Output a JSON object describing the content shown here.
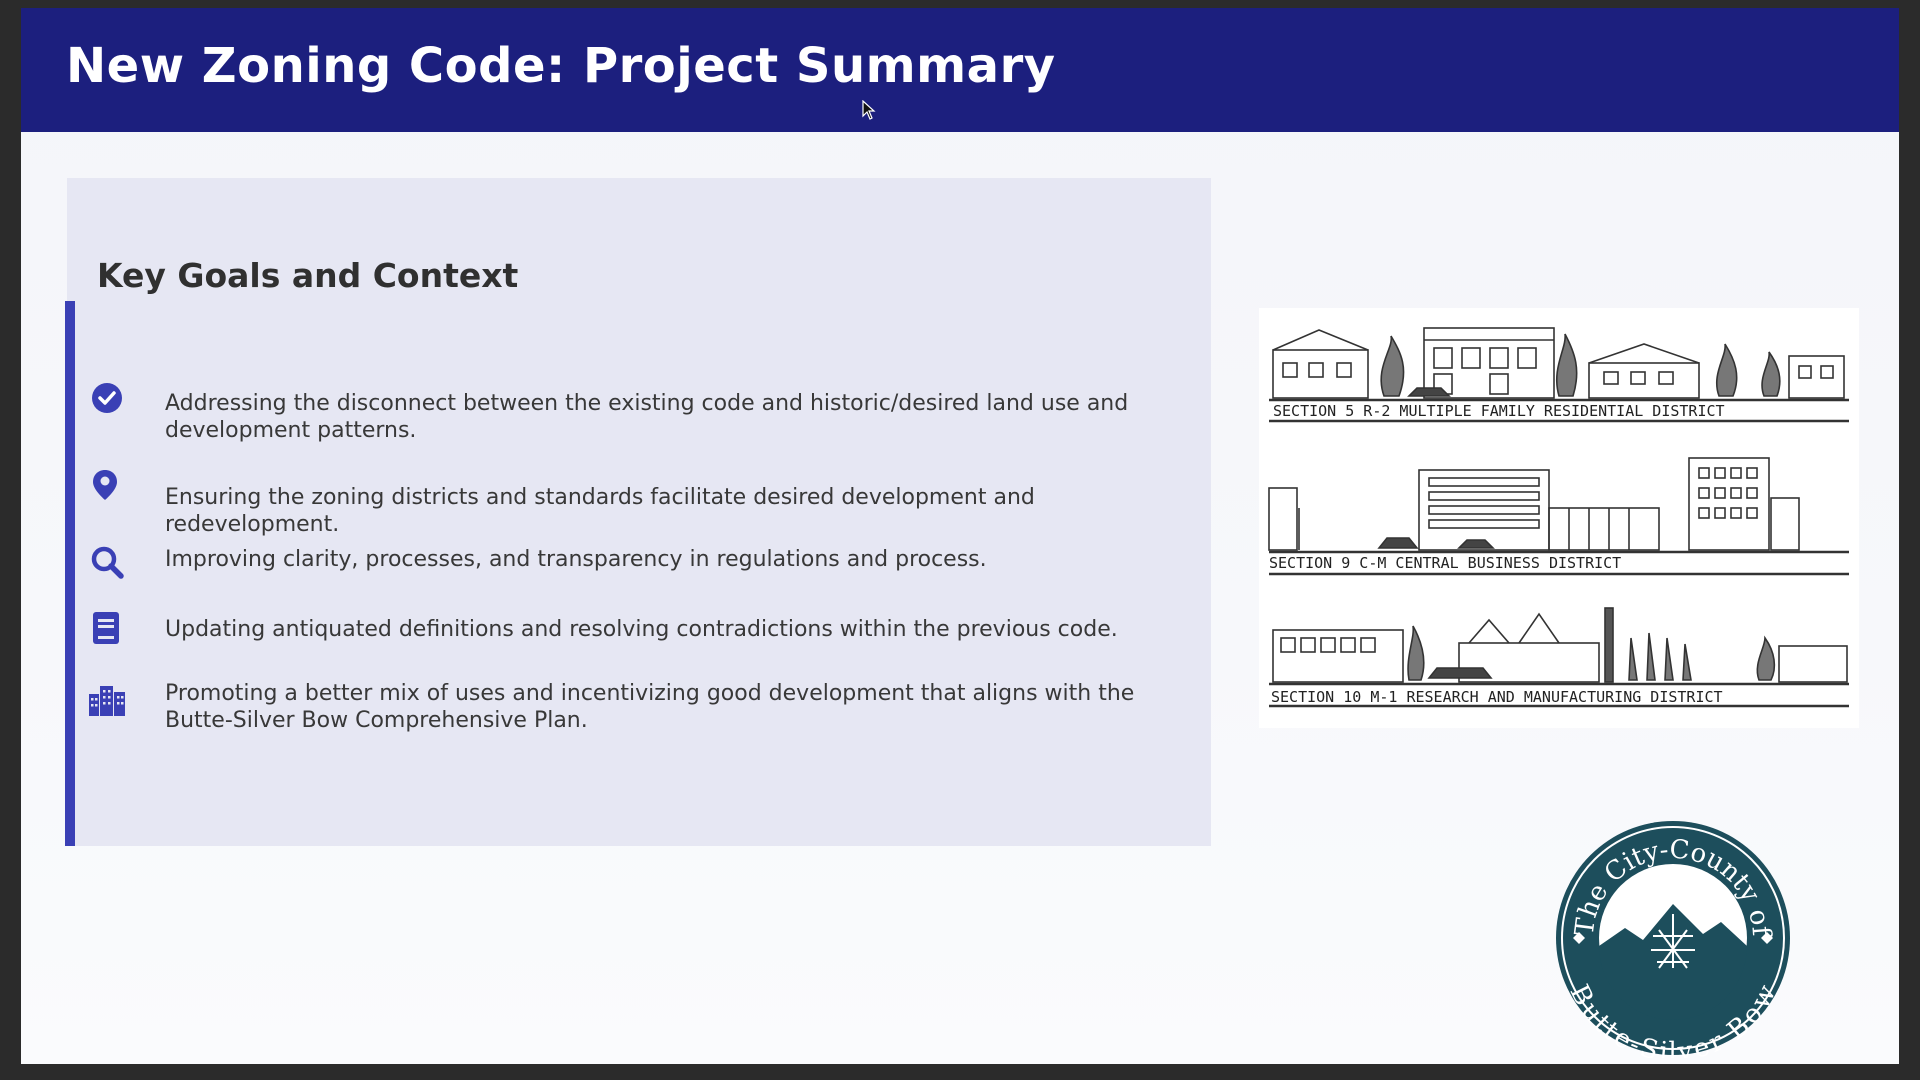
{
  "slide": {
    "title": "New Zoning Code: Project Summary"
  },
  "goals": {
    "heading": "Key Goals and Context",
    "items": [
      {
        "icon": "check-circle-icon",
        "text": "Addressing the disconnect between the existing code and historic/desired land use and development patterns."
      },
      {
        "icon": "map-pin-icon",
        "text": "Ensuring the zoning districts and standards facilitate desired development and redevelopment."
      },
      {
        "icon": "search-icon",
        "text": "Improving clarity, processes, and transparency in regulations and process."
      },
      {
        "icon": "document-icon",
        "text": "Updating antiquated definitions and resolving contradictions within the previous code."
      },
      {
        "icon": "city-buildings-icon",
        "text": "Promoting a better mix of uses and incentivizing good development that aligns with the Butte-Silver Bow Comprehensive Plan."
      }
    ]
  },
  "illustration": {
    "sections": [
      "SECTION 5   R-2   MULTIPLE   FAMILY   RESIDENTIAL   DISTRICT",
      "SECTION 9   C-M   CENTRAL   BUSINESS   DISTRICT",
      "SECTION 10   M-1   RESEARCH   AND   MANUFACTURING   DISTRICT"
    ]
  },
  "seal": {
    "top_text": "The City-County of",
    "bottom_text": "Butte-Silver Bow"
  },
  "colors": {
    "title_bar": "#1c1f7e",
    "accent": "#3a40b5",
    "seal": "#1d4e5c"
  }
}
